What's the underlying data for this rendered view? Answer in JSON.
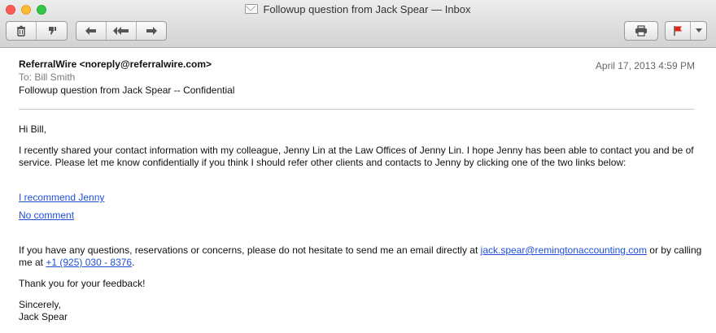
{
  "window": {
    "title": "Followup question from Jack Spear — Inbox"
  },
  "toolbar": {
    "icons": [
      "trash-icon",
      "junk-icon",
      "reply-icon",
      "reply-all-icon",
      "forward-icon",
      "print-icon",
      "flag-icon",
      "chevron-down-icon"
    ],
    "flag_color": "#e0241b"
  },
  "message": {
    "from": "ReferralWire <noreply@referralwire.com>",
    "to": "To: Bill Smith",
    "subject": "Followup question from Jack Spear -- Confidential",
    "date": "April 17, 2013   4:59 PM"
  },
  "body": {
    "greeting": "Hi Bill,",
    "para1": "I recently shared your contact information with my colleague, Jenny Lin at the Law Offices of Jenny Lin. I hope Jenny has been able to contact you and be of service. Please let me know confidentially if you think I should refer other clients and contacts to Jenny by clicking one of the two links below:",
    "link_recommend": "I recommend Jenny ",
    "link_no_comment": "No comment",
    "para2_before": "If you have any questions, reservations or concerns, please do not hesitate to send me an email directly at ",
    "email_link": "jack.spear@remingtonaccounting.com",
    "para2_middle": " or by calling me at ",
    "phone_link": "+1 (925) 030 - 8376",
    "para2_after": ".",
    "thanks": "Thank you for your feedback!",
    "closing": "Sincerely,",
    "signature": "Jack Spear"
  }
}
